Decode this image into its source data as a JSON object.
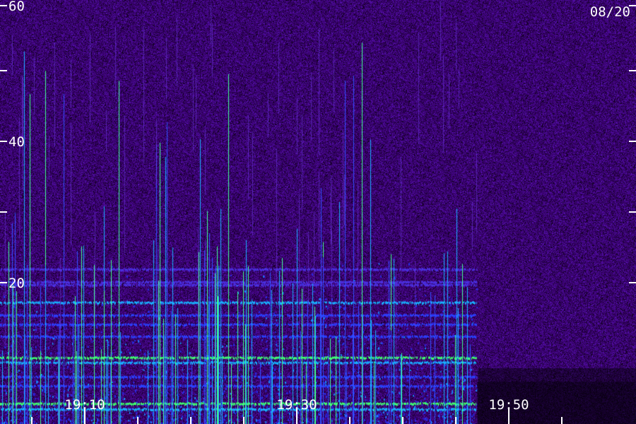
{
  "chart_data": {
    "type": "heatmap",
    "date": "08/20",
    "y_ticks": [
      {
        "value": 60,
        "label": "60"
      },
      {
        "value": 50,
        "label": ""
      },
      {
        "value": 40,
        "label": "40"
      },
      {
        "value": 30,
        "label": ""
      },
      {
        "value": 20,
        "label": "20"
      }
    ],
    "ylim": [
      0,
      60
    ],
    "x_labels": [
      {
        "time": "19:10",
        "label": "19:10"
      },
      {
        "time": "19:30",
        "label": "19:30"
      },
      {
        "time": "19:50",
        "label": "19:50"
      }
    ],
    "x_minor_ticks": [
      "19:05",
      "19:10",
      "19:15",
      "19:20",
      "19:25",
      "19:30",
      "19:35",
      "19:40",
      "19:45",
      "19:50",
      "19:55"
    ],
    "xlim": [
      "19:02",
      "20:02"
    ],
    "data_end_time": "19:47",
    "colormap": [
      "#250040",
      "#3a0a8a",
      "#2020d8",
      "#1aa0ff",
      "#40ff70",
      "#ffffff"
    ],
    "bands": [
      {
        "freq": 22,
        "color": "#4a30e0"
      },
      {
        "freq": 20.2,
        "color": "#4a30e0"
      },
      {
        "freq": 19.8,
        "color": "#4a30e0"
      },
      {
        "freq": 17.3,
        "color": "#18b0ff"
      },
      {
        "freq": 15.5,
        "color": "#2a40ff"
      },
      {
        "freq": 14.2,
        "color": "#2a40ff"
      },
      {
        "freq": 12.5,
        "color": "#2a40ff"
      },
      {
        "freq": 9.5,
        "color": "#40ff70"
      },
      {
        "freq": 8.8,
        "color": "#18b0ff"
      },
      {
        "freq": 6.8,
        "color": "#2a40ff"
      },
      {
        "freq": 5.5,
        "color": "#2a40ff"
      },
      {
        "freq": 3.0,
        "color": "#40ff70"
      },
      {
        "freq": 2.2,
        "color": "#18b0ff"
      }
    ]
  }
}
